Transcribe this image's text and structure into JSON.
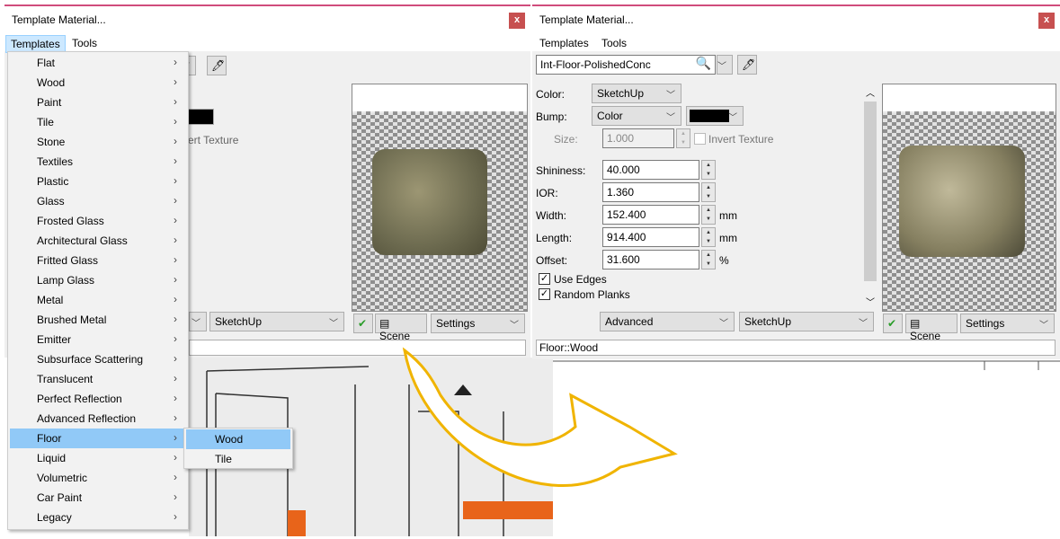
{
  "left_dialog": {
    "title": "Template Material...",
    "close": "x",
    "menu": [
      "Templates",
      "Tools"
    ],
    "invert_texture_partial": "vert Texture",
    "bottom_combo": "SketchUp",
    "scene": "Scene",
    "settings": "Settings"
  },
  "templates_menu": {
    "items": [
      "Flat",
      "Wood",
      "Paint",
      "Tile",
      "Stone",
      "Textiles",
      "Plastic",
      "Glass",
      "Frosted Glass",
      "Architectural Glass",
      "Fritted Glass",
      "Lamp Glass",
      "Metal",
      "Brushed Metal",
      "Emitter",
      "Subsurface Scattering",
      "Translucent",
      "Perfect Reflection",
      "Advanced Reflection",
      "Floor",
      "Liquid",
      "Volumetric",
      "Car Paint",
      "Legacy"
    ],
    "highlighted": "Floor",
    "submenu": [
      "Wood",
      "Tile"
    ],
    "submenu_highlighted": "Wood"
  },
  "right_dialog": {
    "title": "Template Material...",
    "close": "x",
    "menu": [
      "Templates",
      "Tools"
    ],
    "material_name": "Int-Floor-PolishedConc",
    "color_label": "Color:",
    "color_value": "SketchUp",
    "bump_label": "Bump:",
    "bump_value": "Color",
    "size_label": "Size:",
    "size_value": "1.000",
    "invert_texture": "Invert Texture",
    "fields": [
      {
        "label": "Shininess:",
        "value": "40.000",
        "unit": ""
      },
      {
        "label": "IOR:",
        "value": "1.360",
        "unit": ""
      },
      {
        "label": "Width:",
        "value": "152.400",
        "unit": "mm"
      },
      {
        "label": "Length:",
        "value": "914.400",
        "unit": "mm"
      },
      {
        "label": "Offset:",
        "value": "31.600",
        "unit": "%"
      }
    ],
    "use_edges": "Use Edges",
    "random_planks": "Random Planks",
    "mode_combo": "Advanced",
    "renderer_combo": "SketchUp",
    "scene": "Scene",
    "settings": "Settings",
    "status": "Floor::Wood"
  },
  "colors": {
    "accent_border": "#d04c7c",
    "close_bg": "#c75050",
    "highlight": "#91c9f7",
    "arrow": "#f0b400"
  }
}
